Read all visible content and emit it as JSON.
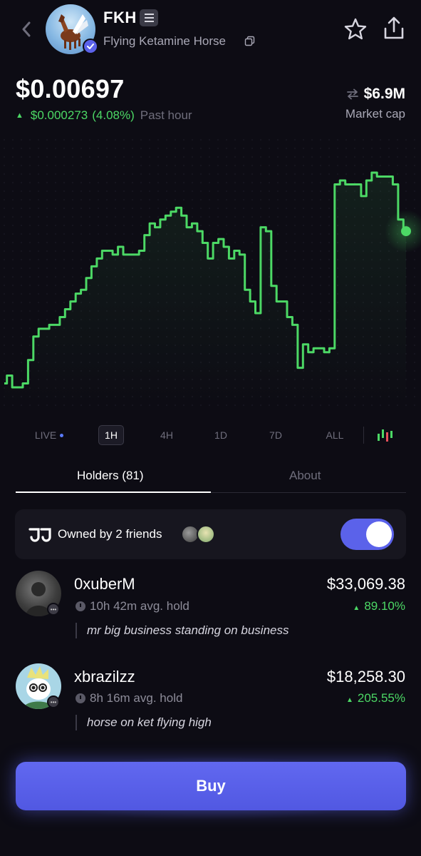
{
  "header": {
    "ticker": "FKH",
    "name": "Flying Ketamine Horse"
  },
  "price": {
    "current": "$0.00697",
    "change_value": "$0.000273",
    "change_percent": "(4.08%)",
    "period": "Past hour",
    "market_cap_value": "$6.9M",
    "market_cap_label": "Market cap"
  },
  "chart_data": {
    "type": "line",
    "color": "#4cd865",
    "background": "#0d0c14",
    "grid": false,
    "y": [
      0.00658,
      0.0066,
      0.00657,
      0.00657,
      0.00658,
      0.00664,
      0.0067,
      0.00672,
      0.00672,
      0.00673,
      0.00673,
      0.00675,
      0.00677,
      0.00679,
      0.00681,
      0.00682,
      0.00685,
      0.00688,
      0.0069,
      0.00692,
      0.00692,
      0.00691,
      0.00693,
      0.00691,
      0.00691,
      0.00691,
      0.00692,
      0.00696,
      0.00699,
      0.00698,
      0.007,
      0.00701,
      0.00702,
      0.00703,
      0.00701,
      0.00698,
      0.00699,
      0.00697,
      0.00694,
      0.0069,
      0.00694,
      0.00695,
      0.00693,
      0.0069,
      0.00692,
      0.00691,
      0.00682,
      0.00679,
      0.00676,
      0.00698,
      0.00697,
      0.00683,
      0.00679,
      0.00679,
      0.00675,
      0.00673,
      0.00662,
      0.00668,
      0.00666,
      0.00667,
      0.00667,
      0.00666,
      0.00667,
      0.00709,
      0.0071,
      0.00709,
      0.00709,
      0.00709,
      0.00706,
      0.0071,
      0.00712,
      0.00711,
      0.00711,
      0.00711,
      0.00709,
      0.007,
      0.00697
    ]
  },
  "timeframes": [
    "LIVE",
    "1H",
    "4H",
    "1D",
    "7D",
    "ALL"
  ],
  "active_timeframe": "1H",
  "tabs": {
    "holders": "Holders (81)",
    "about": "About"
  },
  "friends": {
    "label": "Owned by 2 friends",
    "toggle_on": true
  },
  "holders": [
    {
      "name": "0xuberM",
      "hold": "10h 42m avg. hold",
      "quote": "mr big business standing on business",
      "value": "$33,069.38",
      "percent": "89.10%"
    },
    {
      "name": "xbrazilzz",
      "hold": "8h 16m avg. hold",
      "quote": "horse on ket flying high",
      "value": "$18,258.30",
      "percent": "205.55%"
    }
  ],
  "buy_label": "Buy",
  "colors": {
    "accent": "#5b62ea",
    "positive": "#4cd865",
    "background": "#0d0c14"
  }
}
